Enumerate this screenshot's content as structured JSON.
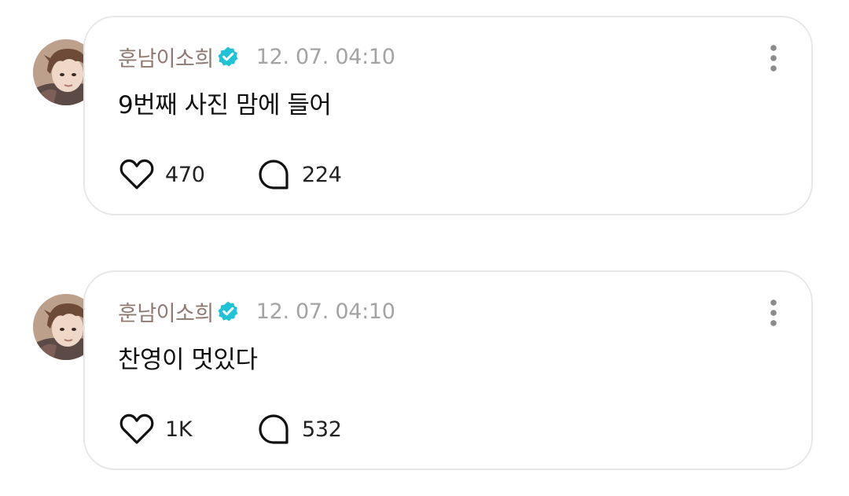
{
  "colors": {
    "author": "#8e7a72",
    "timestamp": "#a3a3a3",
    "verified_badge": "#1fc3d6",
    "card_border": "#e7e7e7",
    "text": "#111111"
  },
  "posts": [
    {
      "author": "훈남이소희",
      "verified": true,
      "timestamp": "12. 07. 04:10",
      "content": "9번째 사진 맘에 들어",
      "likes": "470",
      "comments": "224",
      "icons": {
        "like": "heart-icon",
        "comment": "comment-bubble-icon",
        "more": "more-vertical-icon"
      }
    },
    {
      "author": "훈남이소희",
      "verified": true,
      "timestamp": "12. 07. 04:10",
      "content": "찬영이 멋있다",
      "likes": "1K",
      "comments": "532",
      "icons": {
        "like": "heart-icon",
        "comment": "comment-bubble-icon",
        "more": "more-vertical-icon"
      }
    }
  ]
}
